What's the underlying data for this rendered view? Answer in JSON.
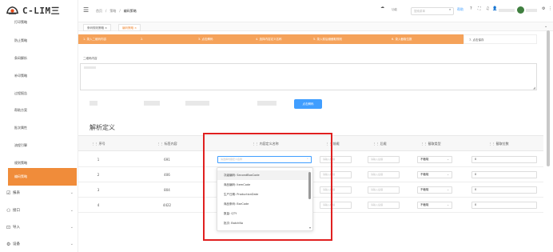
{
  "brand": {
    "name": "C-LIM三",
    "accent": "#f08c3a",
    "primary": "#409eff",
    "highlight": "#e02020"
  },
  "sidebar": {
    "items": [
      {
        "label": "打印策略"
      },
      {
        "label": "防止策略"
      },
      {
        "label": "条码解析"
      },
      {
        "label": "补印策略"
      },
      {
        "label": "过程报告"
      },
      {
        "label": "帮助方案"
      },
      {
        "label": "批次属性"
      },
      {
        "label": "流程引擎"
      },
      {
        "label": "规则策略"
      },
      {
        "label": "编码策略"
      }
    ],
    "groups": [
      {
        "label": "报表",
        "icon": "report-icon"
      },
      {
        "label": "接口",
        "icon": "interface-icon"
      },
      {
        "label": "导入",
        "icon": "import-icon"
      },
      {
        "label": "设备",
        "icon": "device-icon"
      }
    ]
  },
  "header": {
    "breadcrumb": [
      "首页",
      "策略",
      "编码策略"
    ],
    "search_placeholder": "搜索菜单",
    "help_label": "帮助",
    "settings_label": "功能"
  },
  "tabs": [
    {
      "label": "条码规则策略"
    },
    {
      "label": "编码策略"
    }
  ],
  "steps": [
    "1. 录入二维码内容",
    "2.",
    "3. 点击解码",
    "4. 选择内容定义名称",
    "5. 录入前后缀截取规则",
    "6. 录入截取位数",
    "7. 点击保存"
  ],
  "form": {
    "qr_label": "二维码内容",
    "decode_button": "点击解码"
  },
  "section_title": "解析定义",
  "table": {
    "columns": [
      "序号",
      "标签内容",
      "内容定义名称",
      "前缀",
      "后缀",
      "截取类型",
      "截取位数"
    ],
    "name_placeholder": "请选择内容定义名称",
    "prefix_placeholder": "请输入前缀",
    "suffix_placeholder": "请输入后缀",
    "rows": [
      {
        "seq": "1",
        "content": "691",
        "type": "不截取",
        "digits": "0"
      },
      {
        "seq": "2",
        "content": "406",
        "type": "不截取",
        "digits": "0"
      },
      {
        "seq": "3",
        "content": "804",
        "type": "不截取",
        "digits": "0"
      },
      {
        "seq": "4",
        "content": "4422",
        "type": "不截取",
        "digits": "0"
      }
    ]
  },
  "dropdown": {
    "options": [
      "次级编码: SecondBoxCode",
      "商品编码: ItemCode",
      "生产日期: ProductionDate",
      "商品条码: BarCode",
      "数量: QTY",
      "批次: BatchNo"
    ]
  }
}
